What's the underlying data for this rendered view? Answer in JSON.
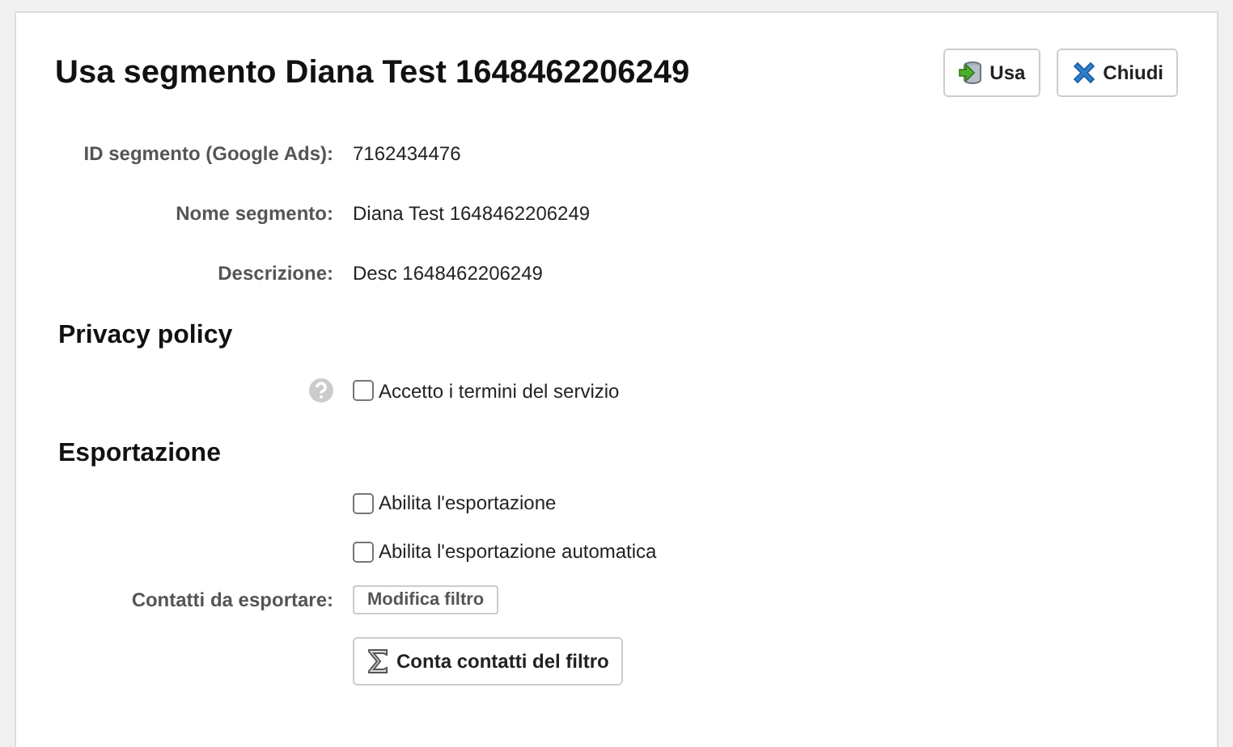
{
  "title": "Usa segmento Diana Test 1648462206249",
  "actions": [
    {
      "kind": "use",
      "label": "Usa"
    },
    {
      "kind": "close",
      "label": "Chiudi"
    }
  ],
  "fields": [
    {
      "label": "ID segmento (Google Ads):",
      "value": "7162434476"
    },
    {
      "label": "Nome segmento:",
      "value": "Diana Test 1648462206249"
    },
    {
      "label": "Descrizione:",
      "value": "Desc 1648462206249"
    }
  ],
  "privacy": {
    "heading": "Privacy policy",
    "checkbox": {
      "label": "Accetto i termini del servizio",
      "checked": false
    }
  },
  "export": {
    "heading": "Esportazione",
    "checkboxes": [
      {
        "label": "Abilita l'esportazione",
        "checked": false
      },
      {
        "label": "Abilita l'esportazione automatica",
        "checked": false
      }
    ],
    "contacts_label": "Contatti da esportare:",
    "filter_button": "Modifica filtro",
    "count_button": "Conta contatti del filtro"
  }
}
